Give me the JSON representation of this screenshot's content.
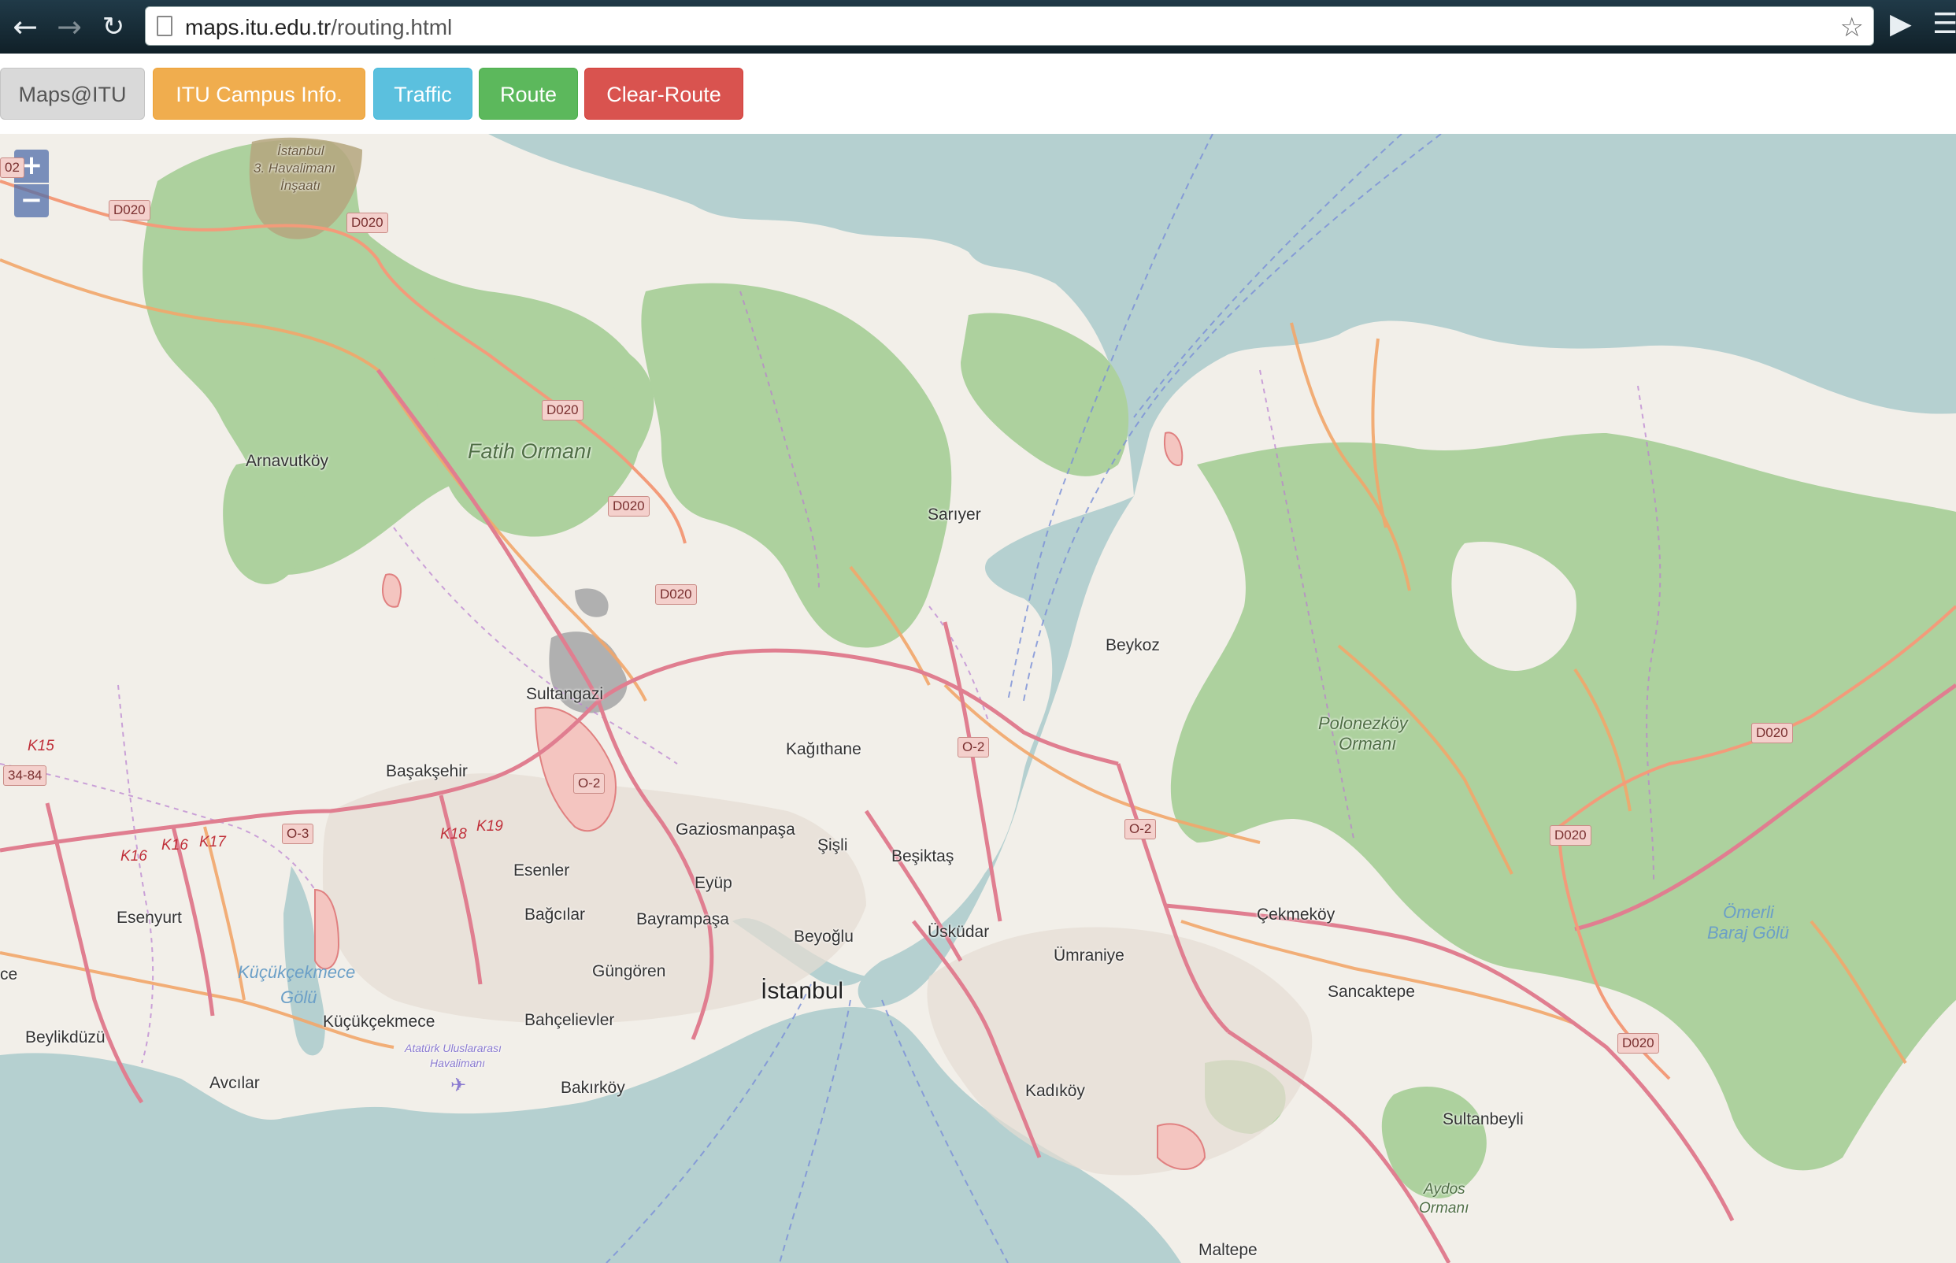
{
  "browser": {
    "url_host": "maps.itu.edu.tr",
    "url_path": "/routing.html",
    "icons": [
      "back-arrow-icon",
      "forward-arrow-icon",
      "reload-icon",
      "page-icon",
      "star-icon",
      "extension-icon",
      "menu-icon"
    ]
  },
  "toolbar": {
    "brand_label": "Maps@ITU",
    "campus_label": "ITU Campus Info.",
    "traffic_label": "Traffic",
    "route_label": "Route",
    "clear_label": "Clear-Route",
    "colors": {
      "default": "#d9d9d9",
      "campus": "#f0ad4e",
      "traffic": "#5bc0de",
      "route": "#5cb85c",
      "clear": "#d9534f"
    }
  },
  "map": {
    "zoom_in": "+",
    "zoom_out": "−",
    "colors": {
      "land": "#f2efe9",
      "sea": "#b5d0d0",
      "forest": "#add19e",
      "motorway": "#e07e90",
      "trunk": "#f2a66a",
      "boundary": "#b97fd0"
    },
    "places": {
      "istanbul": "İstanbul",
      "arnavutkoy": "Arnavutköy",
      "sariyer": "Sarıyer",
      "beykoz": "Beykoz",
      "sultangazi": "Sultangazi",
      "basaksehir": "Başakşehir",
      "kagithane": "Kağıthane",
      "gaziosmanpasa": "Gaziosmanpaşa",
      "sisli": "Şişli",
      "besiktas": "Beşiktaş",
      "esenler": "Esenler",
      "eyup": "Eyüp",
      "bagcilar": "Bağcılar",
      "bayrampasa": "Bayrampaşa",
      "beyoglu": "Beyoğlu",
      "uskudar": "Üsküdar",
      "umraniye": "Ümraniye",
      "gungoren": "Güngören",
      "esenyurt": "Esenyurt",
      "kucukcekmece": "Küçükçekmece",
      "bahcelievler": "Bahçelievler",
      "beylikduzu": "Beylikdüzü",
      "avcilar": "Avcılar",
      "bakirkoy": "Bakırköy",
      "kadikoy": "Kadıköy",
      "cekmekoy": "Çekmeköy",
      "sancaktepe": "Sancaktepe",
      "sultanbeyli": "Sultanbeyli",
      "maltepe": "Maltepe",
      "ce": "ce"
    },
    "forests": {
      "fatih": "Fatih Ormanı",
      "polonezkoy_1": "Polonezköy",
      "polonezkoy_2": "Ormanı",
      "aydos_1": "Aydos",
      "aydos_2": "Ormanı"
    },
    "waters": {
      "kucukcekmece_1": "Küçükçekmece",
      "kucukcekmece_2": "Gölü",
      "omerli_1": "Ömerli",
      "omerli_2": "Baraj Gölü"
    },
    "sites": {
      "airport_new_1": "İstanbul",
      "airport_new_2": "3. Havalimanı",
      "airport_new_3": "İnşaatı",
      "ataturk_1": "Atatürk Uluslararası",
      "ataturk_2": "Havalimanı"
    },
    "shields": {
      "d020": "D020",
      "o2": "O-2",
      "o3": "O-3",
      "k15": "K15",
      "k16": "K16",
      "k17": "K17",
      "k18": "K18",
      "k19": "K19",
      "r3484": "34-84",
      "d02": "02"
    }
  }
}
